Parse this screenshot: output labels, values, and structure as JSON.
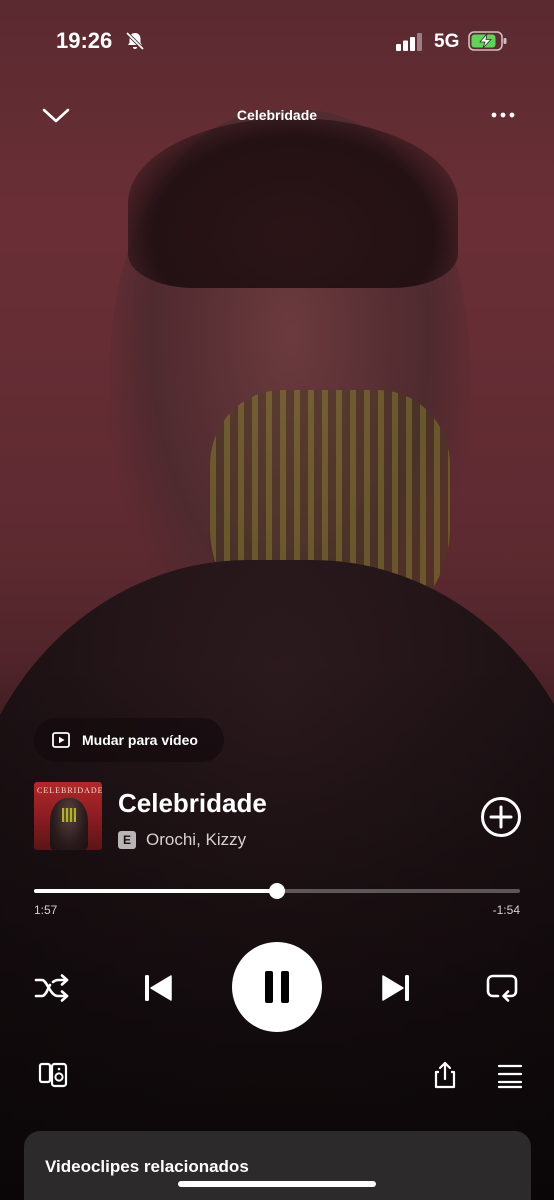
{
  "status_bar": {
    "time": "19:26",
    "network": "5G",
    "battery_charging": true,
    "icons": [
      "bell-muted-icon",
      "signal-icon",
      "battery-charging-icon"
    ]
  },
  "header": {
    "title": "Celebridade",
    "icons": [
      "chevron-down-icon",
      "more-icon"
    ]
  },
  "video_toggle": {
    "label": "Mudar para vídeo",
    "icon": "play-square-icon"
  },
  "track": {
    "title": "Celebridade",
    "explicit_badge": "E",
    "artists": "Orochi, Kizzy",
    "cover_text": "CELEBRIDADE",
    "add_icon": "plus-circle-icon"
  },
  "playback": {
    "elapsed": "1:57",
    "remaining": "-1:54",
    "progress_fraction": 0.5
  },
  "controls": {
    "icons": [
      "shuffle-icon",
      "previous-icon",
      "pause-icon",
      "next-icon",
      "repeat-icon"
    ],
    "state": "playing"
  },
  "bottom_actions": {
    "icons": [
      "connect-device-icon",
      "share-icon",
      "queue-icon"
    ]
  },
  "related": {
    "title": "Videoclipes relacionados"
  }
}
